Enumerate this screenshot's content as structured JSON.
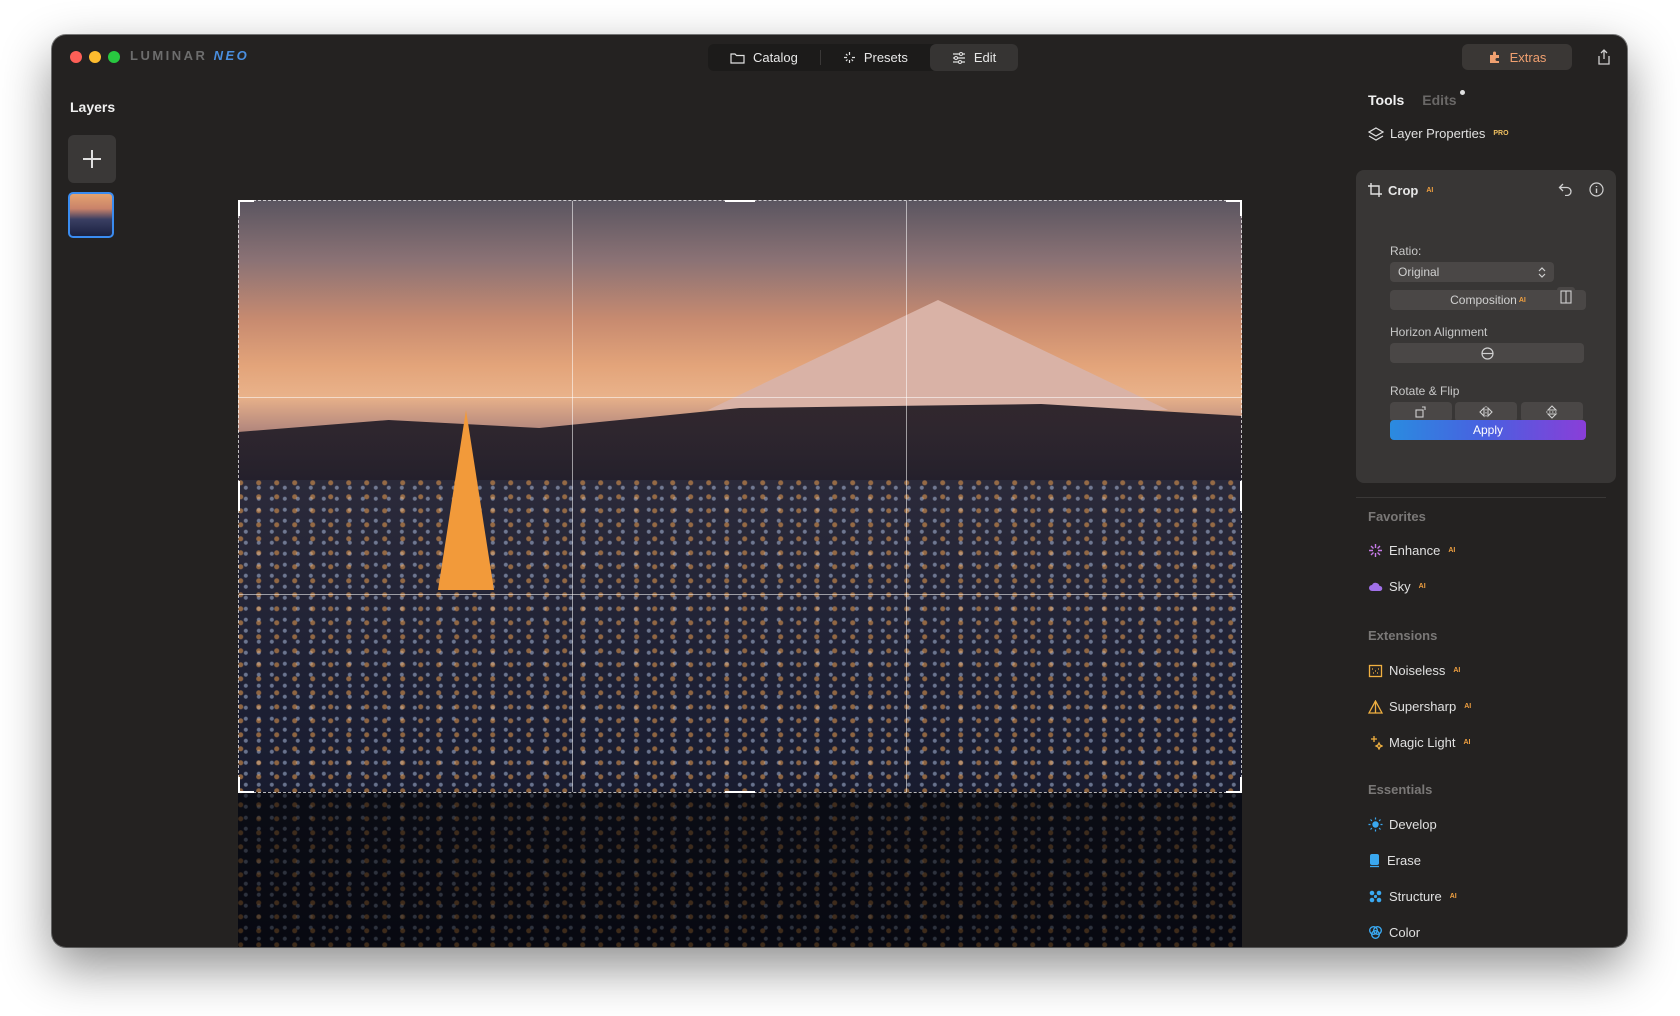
{
  "app": {
    "logo_part1": "LUMINAR",
    "logo_part2": "NEO"
  },
  "modes": [
    {
      "label": "Catalog",
      "icon": "folder-icon",
      "active": false
    },
    {
      "label": "Presets",
      "icon": "sparkle-icon",
      "active": false
    },
    {
      "label": "Edit",
      "icon": "sliders-icon",
      "active": true
    }
  ],
  "toolbar": {
    "extras_label": "Extras",
    "extras_color": "#f0a070"
  },
  "layers": {
    "title": "Layers"
  },
  "panel": {
    "tabs": {
      "tools": "Tools",
      "edits": "Edits"
    },
    "layer_properties": "Layer Properties",
    "pro_badge": "PRO",
    "ai_badge": "AI",
    "crop": {
      "title": "Crop",
      "ratio_label": "Ratio:",
      "ratio_value": "Original",
      "composition_label": "Composition",
      "horizon_label": "Horizon Alignment",
      "rotate_flip_label": "Rotate & Flip",
      "apply_label": "Apply"
    },
    "favorites": {
      "title": "Favorites",
      "items": [
        {
          "label": "Enhance",
          "icon": "enhance-icon",
          "color": "#c77be8"
        },
        {
          "label": "Sky",
          "icon": "cloud-icon",
          "color": "#a070e8"
        }
      ]
    },
    "extensions": {
      "title": "Extensions",
      "items": [
        {
          "label": "Noiseless",
          "icon": "noiseless-icon",
          "color": "#f0b040"
        },
        {
          "label": "Supersharp",
          "icon": "supersharp-icon",
          "color": "#f0b040"
        },
        {
          "label": "Magic Light",
          "icon": "magic-light-icon",
          "color": "#f0b040"
        }
      ]
    },
    "essentials": {
      "title": "Essentials",
      "items": [
        {
          "label": "Develop",
          "icon": "sun-icon",
          "color": "#3aa8f0"
        },
        {
          "label": "Erase",
          "icon": "eraser-icon",
          "color": "#3aa8f0"
        },
        {
          "label": "Structure",
          "icon": "structure-icon",
          "color": "#3aa8f0"
        },
        {
          "label": "Color",
          "icon": "color-icon",
          "color": "#3aa8f0"
        }
      ]
    }
  },
  "colors": {
    "accent_blue": "#3a8cf0",
    "background": "#242221",
    "apply_gradient_start": "#2a8be0",
    "apply_gradient_end": "#8a3ed8"
  }
}
